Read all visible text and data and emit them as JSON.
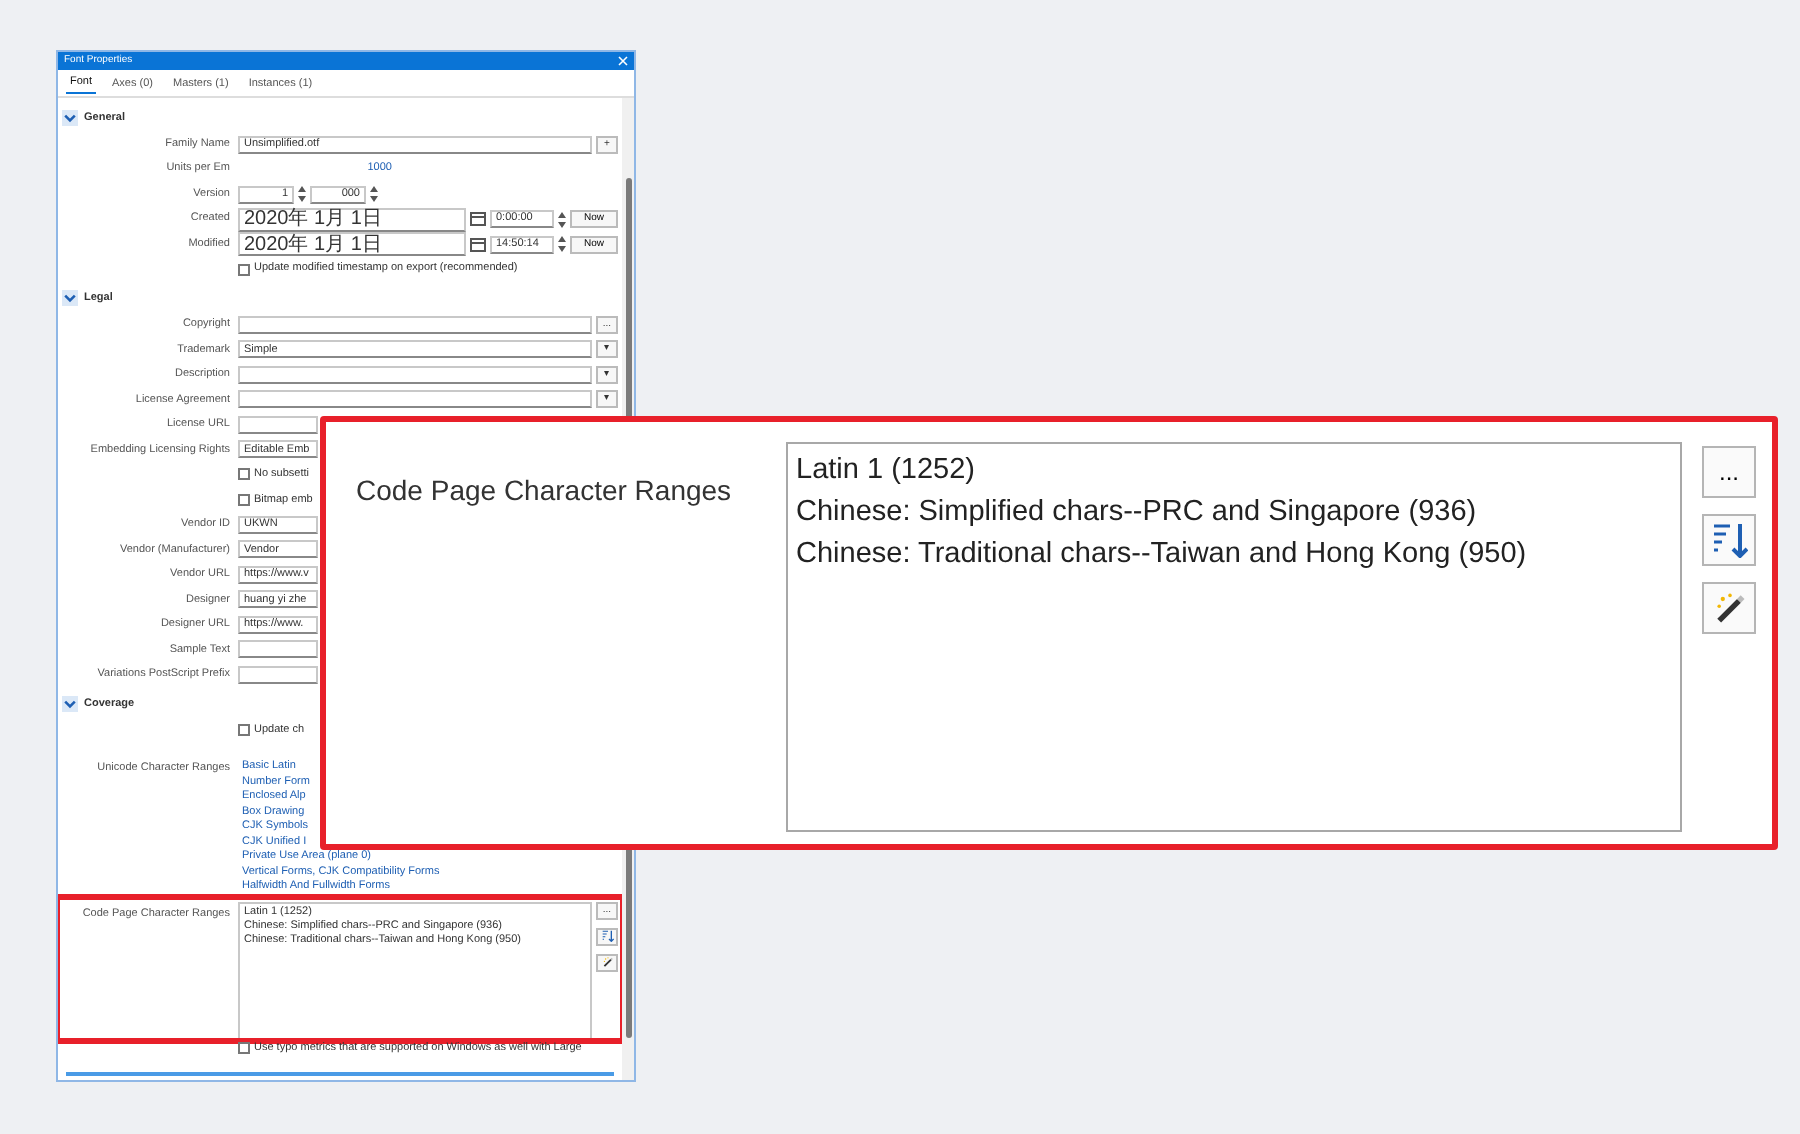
{
  "window": {
    "title": "Font Properties",
    "tabs": [
      {
        "label": "Font",
        "selected": true
      },
      {
        "label": "Axes (0)",
        "selected": false
      },
      {
        "label": "Masters (1)",
        "selected": false
      },
      {
        "label": "Instances (1)",
        "selected": false
      }
    ],
    "sections": [
      {
        "title": "General",
        "expanded": true,
        "rows": [
          {
            "kind": "text",
            "label": "Family Name",
            "value": "Unsimplified.otf",
            "button": "+"
          },
          {
            "kind": "number",
            "label": "Units per Em",
            "value": "1000"
          },
          {
            "kind": "version",
            "label": "Version",
            "major": "1",
            "minor": "000"
          },
          {
            "kind": "datetime",
            "label": "Created",
            "date": "2020年 1月 1日",
            "time": "0:00:00",
            "action": "Now"
          },
          {
            "kind": "datetime",
            "label": "Modified",
            "date": "2020年 1月 1日",
            "time": "14:50:14",
            "action": "Now"
          },
          {
            "kind": "check",
            "text": "Update modified timestamp on export (recommended)",
            "checked": false
          }
        ]
      },
      {
        "title": "Legal",
        "expanded": true,
        "rows": [
          {
            "kind": "text",
            "label": "Copyright",
            "value": "",
            "button": "..."
          },
          {
            "kind": "text",
            "label": "Trademark",
            "value": "Simple",
            "button": "▾"
          },
          {
            "kind": "text",
            "label": "Description",
            "value": "",
            "button": "▾"
          },
          {
            "kind": "text",
            "label": "License Agreement",
            "value": "",
            "button": "▾"
          },
          {
            "kind": "text",
            "label": "License URL",
            "value": ""
          },
          {
            "kind": "select",
            "label": "Embedding Licensing Rights",
            "value": "Editable Emb"
          },
          {
            "kind": "check",
            "text": "No subsetti",
            "checked": false
          },
          {
            "kind": "check",
            "text": "Bitmap emb",
            "checked": false
          },
          {
            "kind": "text",
            "label": "Vendor ID",
            "value": "UKWN"
          },
          {
            "kind": "text",
            "label": "Vendor (Manufacturer)",
            "value": "Vendor"
          },
          {
            "kind": "text",
            "label": "Vendor URL",
            "value": "https://www.v"
          },
          {
            "kind": "text",
            "label": "Designer",
            "value": "huang yi zhe"
          },
          {
            "kind": "text",
            "label": "Designer URL",
            "value": "https://www."
          },
          {
            "kind": "text",
            "label": "Sample Text",
            "value": ""
          },
          {
            "kind": "text",
            "label": "Variations PostScript Prefix",
            "value": ""
          }
        ]
      },
      {
        "title": "Coverage",
        "expanded": true,
        "rows": [
          {
            "kind": "check",
            "text": "Update ch",
            "checked": false
          },
          {
            "kind": "ranges",
            "label": "Unicode Character Ranges",
            "items": [
              "Basic Latin",
              "Number Form",
              "Enclosed Alp",
              "Box Drawing",
              "CJK Symbols",
              "CJK Unified I",
              "Private Use Area (plane 0)",
              "Vertical Forms, CJK Compatibility Forms",
              "Halfwidth And Fullwidth Forms"
            ]
          },
          {
            "kind": "codepages",
            "label": "Code Page Character Ranges",
            "more_button": "...",
            "items": [
              "Latin 1 (1252)",
              "Chinese: Simplified chars--PRC and Singapore (936)",
              "Chinese: Traditional chars--Taiwan and Hong Kong (950)"
            ]
          },
          {
            "kind": "check",
            "text": "Use typo metrics that are supported on Windows as well with Large",
            "checked": false
          }
        ]
      }
    ]
  },
  "callout": {
    "label": "Code Page Character Ranges",
    "items": [
      "Latin 1 (1252)",
      "Chinese: Simplified chars--PRC and Singapore (936)",
      "Chinese: Traditional chars--Taiwan and Hong Kong (950)"
    ],
    "more_button": "..."
  }
}
